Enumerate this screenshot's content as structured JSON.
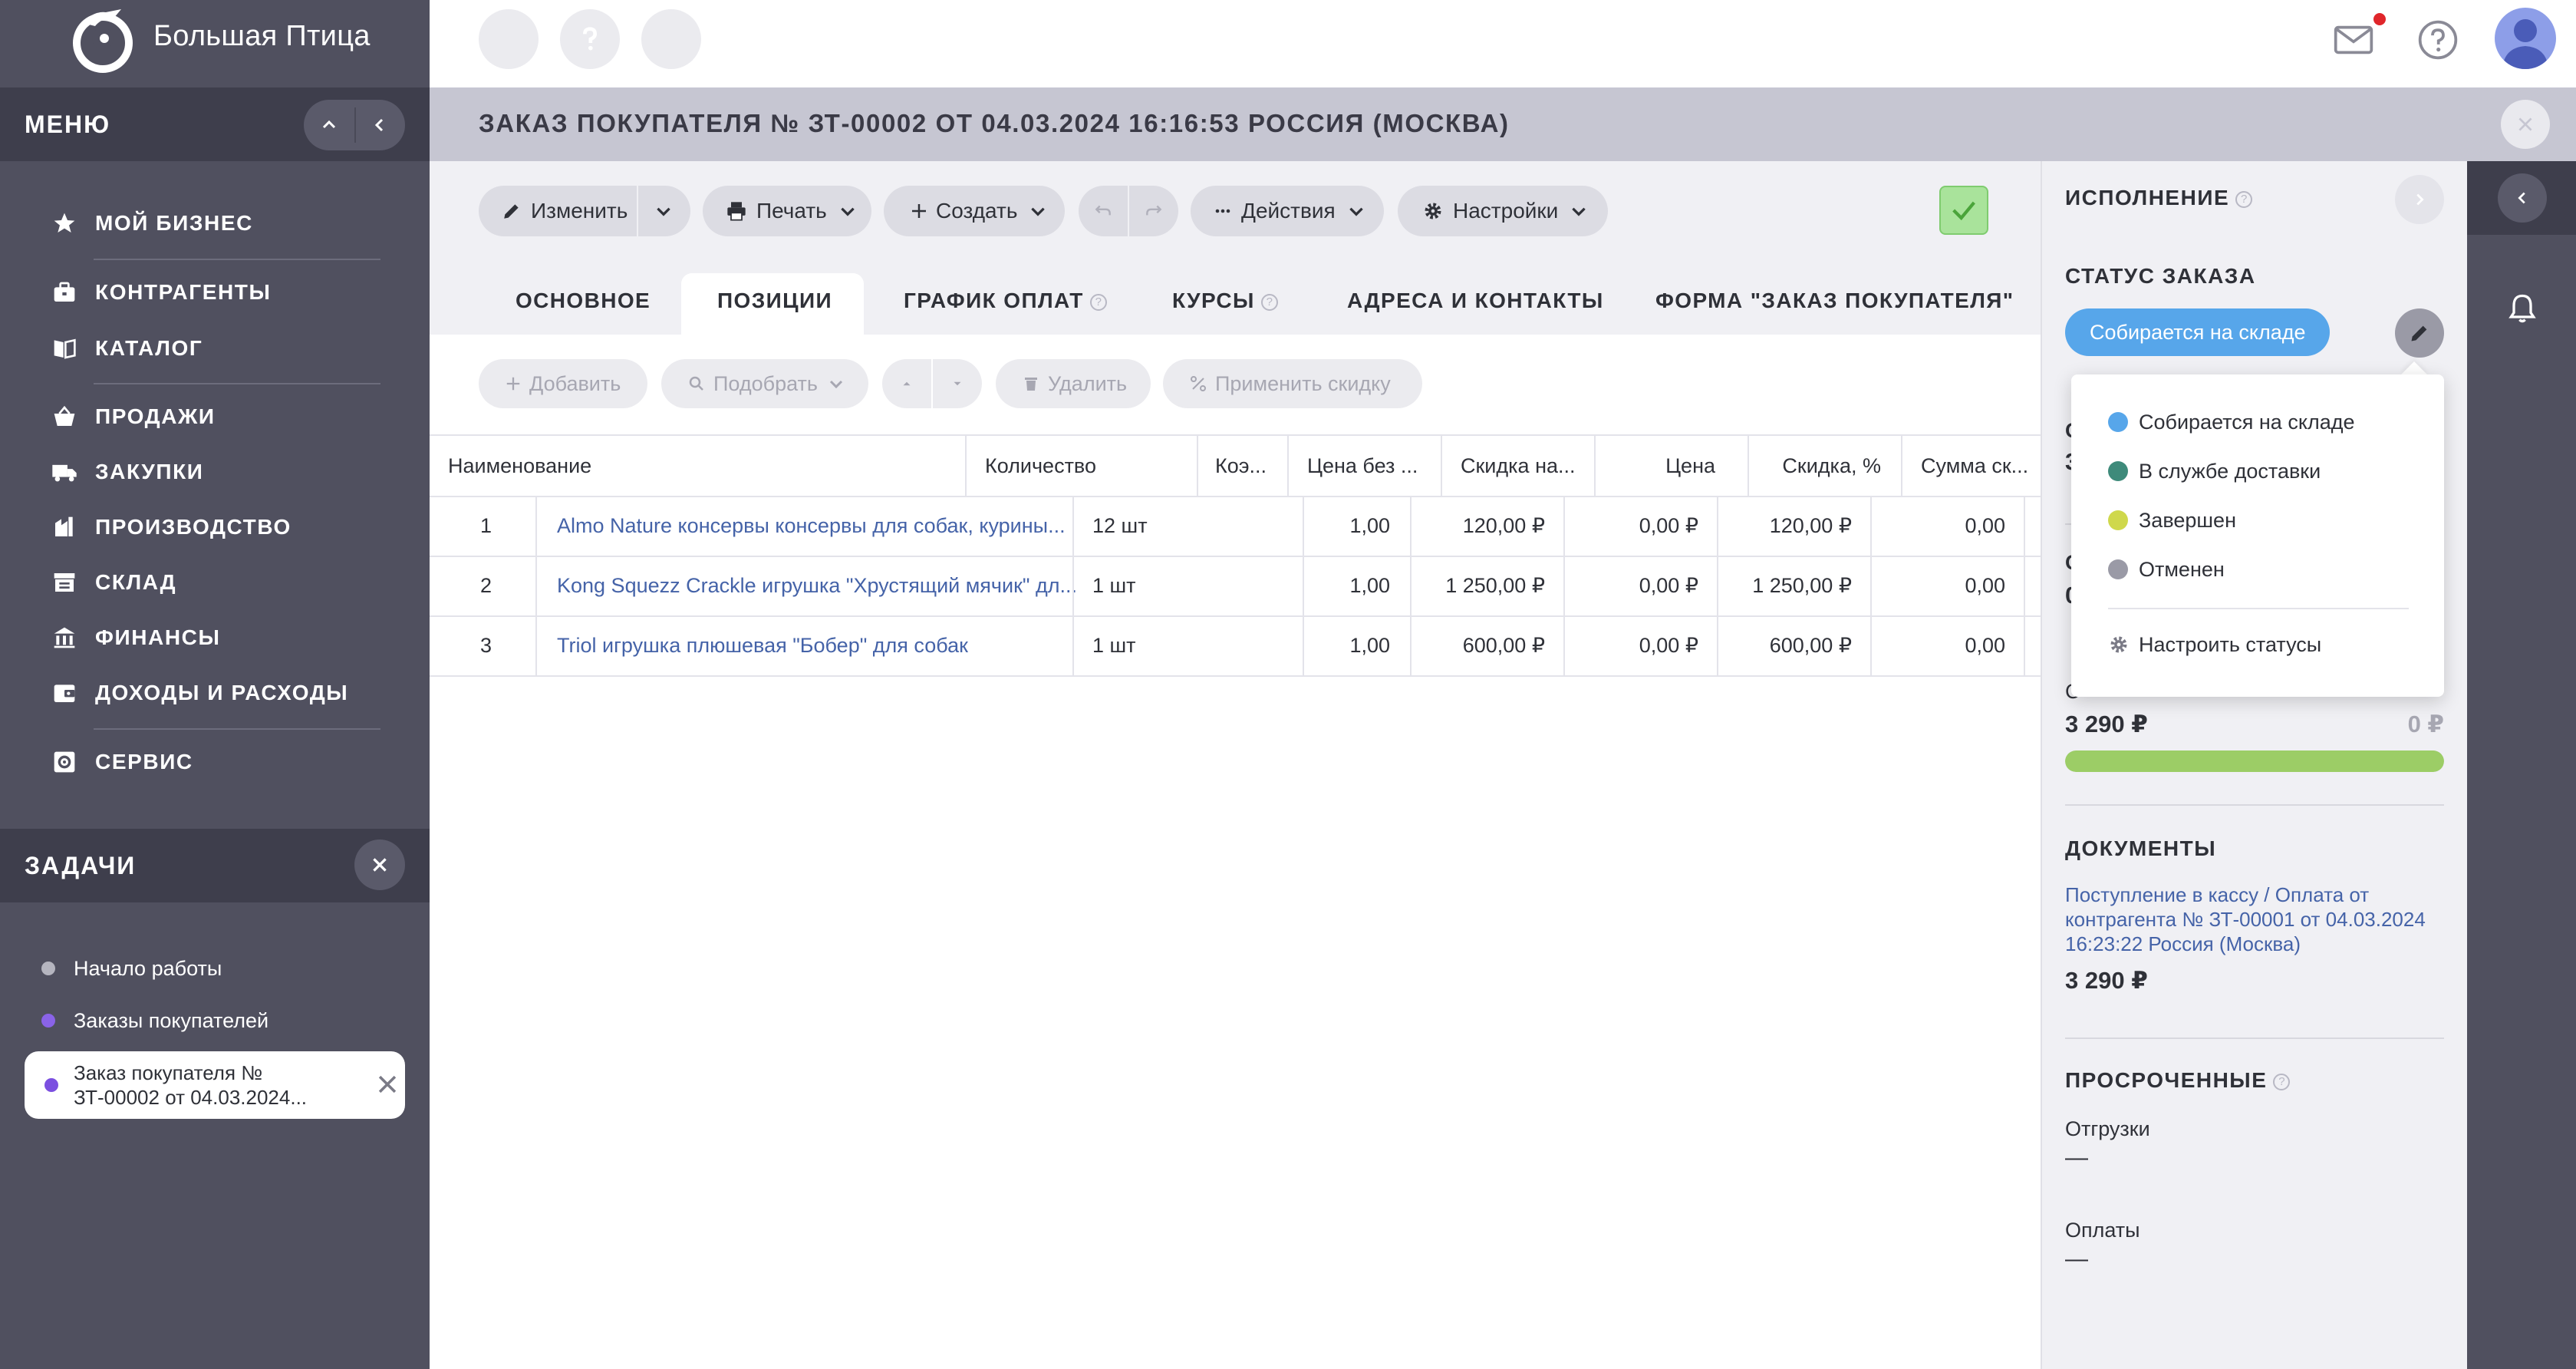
{
  "brand": {
    "name": "Большая Птица"
  },
  "sidebar": {
    "menu_title": "МЕНЮ",
    "items": [
      {
        "label": "МОЙ БИЗНЕС",
        "icon": "star-icon"
      },
      {
        "label": "КОНТРАГЕНТЫ",
        "icon": "briefcase-icon"
      },
      {
        "label": "КАТАЛОГ",
        "icon": "book-icon"
      },
      {
        "label": "ПРОДАЖИ",
        "icon": "basket-icon"
      },
      {
        "label": "ЗАКУПКИ",
        "icon": "truck-icon"
      },
      {
        "label": "ПРОИЗВОДСТВО",
        "icon": "factory-icon"
      },
      {
        "label": "СКЛАД",
        "icon": "warehouse-icon"
      },
      {
        "label": "ФИНАНСЫ",
        "icon": "bank-icon"
      },
      {
        "label": "ДОХОДЫ И РАСХОДЫ",
        "icon": "wallet-icon"
      },
      {
        "label": "СЕРВИС",
        "icon": "service-icon"
      }
    ],
    "tasks_title": "ЗАДАЧИ",
    "tasks": [
      {
        "label": "Начало работы",
        "color": "#b5b5bf"
      },
      {
        "label": "Заказы покупателей",
        "color": "#8a63e8"
      }
    ],
    "active_task": {
      "line1": "Заказ покупателя №",
      "line2": "ЗТ-00002 от 04.03.2024...",
      "color": "#7b4fe0"
    }
  },
  "titlebar": {
    "title": "ЗАКАЗ ПОКУПАТЕЛЯ № ЗТ-00002 ОТ 04.03.2024 16:16:53 РОССИЯ (МОСКВА)"
  },
  "toolbar": {
    "edit": "Изменить",
    "print": "Печать",
    "create": "Создать",
    "actions": "Действия",
    "settings": "Настройки"
  },
  "tabs": [
    {
      "label": "ОСНОВНОЕ"
    },
    {
      "label": "ПОЗИЦИИ"
    },
    {
      "label": "ГРАФИК ОПЛАТ"
    },
    {
      "label": "КУРСЫ"
    },
    {
      "label": "АДРЕСА И КОНТАКТЫ"
    },
    {
      "label": "ФОРМА \"ЗАКАЗ ПОКУПАТЕЛЯ\""
    }
  ],
  "subtoolbar": {
    "add": "Добавить",
    "pick": "Подобрать",
    "delete": "Удалить",
    "discount": "Применить скидку"
  },
  "table": {
    "columns": [
      "Наименование",
      "Количество",
      "Коэ...",
      "Цена без ...",
      "Скидка на...",
      "Цена",
      "Скидка, %",
      "Сумма ск..."
    ],
    "rows": [
      {
        "n": "1",
        "name": "Almo Nature консервы консервы для собак, курины...",
        "qty": "12 шт",
        "coef": "1,00",
        "price_wo": "120,00 ₽",
        "disc_on": "0,00 ₽",
        "price": "120,00 ₽",
        "disc_pct": "0,00"
      },
      {
        "n": "2",
        "name": "Kong Squezz Crackle игрушка \"Хрустящий мячик\" дл...",
        "qty": "1 шт",
        "coef": "1,00",
        "price_wo": "1 250,00 ₽",
        "disc_on": "0,00 ₽",
        "price": "1 250,00 ₽",
        "disc_pct": "0,00"
      },
      {
        "n": "3",
        "name": "Triol игрушка плюшевая \"Бобер\" для собак",
        "qty": "1 шт",
        "coef": "1,00",
        "price_wo": "600,00 ₽",
        "disc_on": "0,00 ₽",
        "price": "600,00 ₽",
        "disc_pct": "0,00"
      }
    ]
  },
  "panel": {
    "title": "ИСПОЛНЕНИЕ",
    "status_title": "СТАТУС ЗАКАЗА",
    "status_value": "Собирается на складе",
    "status_options": [
      {
        "label": "Собирается на складе",
        "color": "#57a6ea"
      },
      {
        "label": "В службе доставки",
        "color": "#3e8a7a"
      },
      {
        "label": "Завершен",
        "color": "#cfd84c"
      },
      {
        "label": "Отменен",
        "color": "#9a9aa6"
      }
    ],
    "configure_statuses": "Настроить статусы",
    "paid": "3 290 ₽",
    "remaining": "0 ₽",
    "progress": 1.0,
    "documents_title": "ДОКУМЕНТЫ",
    "document_link": "Поступление в кассу / Оплата от контрагента № ЗТ-00001 от 04.03.2024 16:23:22 Россия (Москва)",
    "document_sum": "3 290 ₽",
    "overdue_title": "ПРОСРОЧЕННЫЕ",
    "shipments_label": "Отгрузки",
    "shipments_value": "—",
    "payments_label": "Оплаты",
    "payments_value": "—",
    "partial_left": [
      "С",
      "3",
      "С",
      "0",
      "С"
    ]
  }
}
